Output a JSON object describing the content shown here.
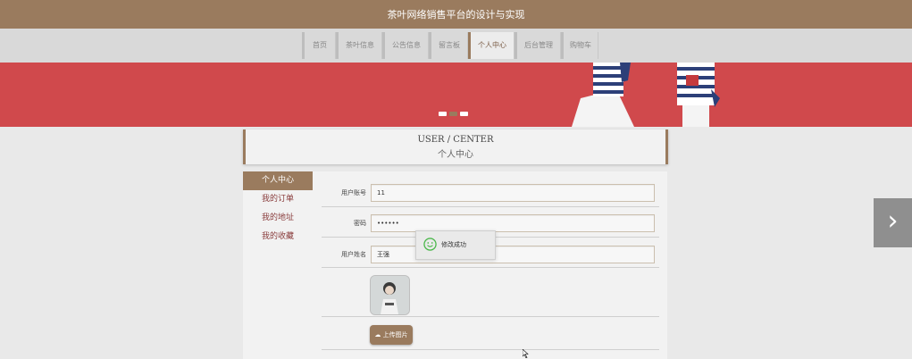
{
  "header": {
    "title": "茶叶网络销售平台的设计与实现"
  },
  "nav": {
    "items": [
      {
        "label": "首页",
        "active": false
      },
      {
        "label": "茶叶信息",
        "active": false
      },
      {
        "label": "公告信息",
        "active": false
      },
      {
        "label": "留言板",
        "active": false
      },
      {
        "label": "个人中心",
        "active": true
      },
      {
        "label": "后台管理",
        "active": false
      },
      {
        "label": "购物车",
        "active": false
      }
    ]
  },
  "banner": {
    "bg_color": "#d0494c",
    "slides": 3,
    "active_slide": 1
  },
  "page_heading": {
    "en": "USER / CENTER",
    "cn": "个人中心"
  },
  "sidebar": {
    "items": [
      {
        "label": "个人中心",
        "active": true
      },
      {
        "label": "我的订单",
        "active": false
      },
      {
        "label": "我的地址",
        "active": false
      },
      {
        "label": "我的收藏",
        "active": false
      }
    ]
  },
  "form": {
    "account_label": "用户账号",
    "account_value": "11",
    "password_label": "密码",
    "password_value": "••••••",
    "name_label": "用户姓名",
    "name_value": "王强",
    "upload_label": "上传图片"
  },
  "toast": {
    "message": "修改成功"
  },
  "colors": {
    "brand": "#9a7b5e",
    "accent": "#d0494c"
  }
}
